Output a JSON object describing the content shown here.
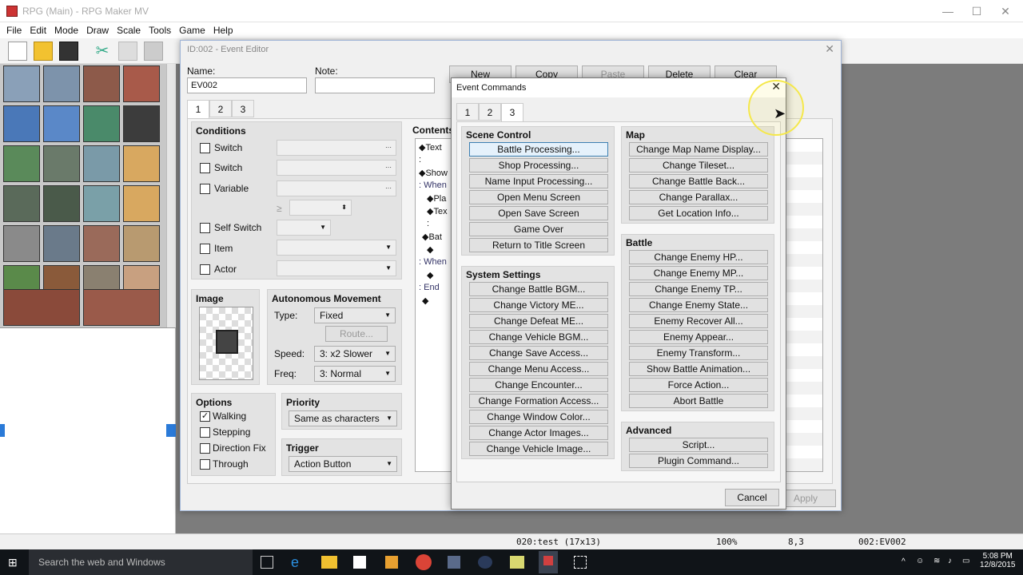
{
  "app": {
    "title": "RPG (Main) - RPG Maker MV",
    "menus": [
      "File",
      "Edit",
      "Mode",
      "Draw",
      "Scale",
      "Tools",
      "Game",
      "Help"
    ]
  },
  "event_editor": {
    "title": "ID:002 - Event Editor",
    "name_label": "Name:",
    "name_value": "EV002",
    "note_label": "Note:",
    "note_value": "",
    "buttons": [
      "New",
      "Copy",
      "Paste",
      "Delete",
      "Clear"
    ],
    "page_tabs": [
      "1",
      "2",
      "3"
    ],
    "conditions": {
      "heading": "Conditions",
      "rows": [
        "Switch",
        "Switch",
        "Variable"
      ],
      "ge": "≥",
      "self_switch": "Self Switch",
      "item": "Item",
      "actor": "Actor"
    },
    "image_heading": "Image",
    "autonomous": {
      "heading": "Autonomous Movement",
      "type_label": "Type:",
      "type_value": "Fixed",
      "route_button": "Route...",
      "speed_label": "Speed:",
      "speed_value": "3: x2 Slower",
      "freq_label": "Freq:",
      "freq_value": "3: Normal"
    },
    "options": {
      "heading": "Options",
      "items": [
        {
          "label": "Walking",
          "checked": true
        },
        {
          "label": "Stepping",
          "checked": false
        },
        {
          "label": "Direction Fix",
          "checked": false
        },
        {
          "label": "Through",
          "checked": false
        }
      ]
    },
    "priority": {
      "heading": "Priority",
      "value": "Same as characters"
    },
    "trigger": {
      "heading": "Trigger",
      "value": "Action Button"
    },
    "contents_heading": "Contents",
    "contents_lines": [
      "◆Text",
      ":",
      "◆Show",
      ": When",
      "◆Pla",
      "◆Tex",
      ":",
      "◆Bat",
      "◆",
      ": When",
      "◆",
      ": End",
      "◆"
    ],
    "apply_button": "Apply"
  },
  "event_commands": {
    "title": "Event Commands",
    "tabs": [
      "1",
      "2",
      "3"
    ],
    "active_tab": "3",
    "groups": {
      "scene_control": {
        "heading": "Scene Control",
        "buttons": [
          "Battle Processing...",
          "Shop Processing...",
          "Name Input Processing...",
          "Open Menu Screen",
          "Open Save Screen",
          "Game Over",
          "Return to Title Screen"
        ]
      },
      "system_settings": {
        "heading": "System Settings",
        "buttons": [
          "Change Battle BGM...",
          "Change Victory ME...",
          "Change Defeat ME...",
          "Change Vehicle BGM...",
          "Change Save Access...",
          "Change Menu Access...",
          "Change Encounter...",
          "Change Formation Access...",
          "Change Window Color...",
          "Change Actor Images...",
          "Change Vehicle Image..."
        ]
      },
      "map": {
        "heading": "Map",
        "buttons": [
          "Change Map Name Display...",
          "Change Tileset...",
          "Change Battle Back...",
          "Change Parallax...",
          "Get Location Info..."
        ]
      },
      "battle": {
        "heading": "Battle",
        "buttons": [
          "Change Enemy HP...",
          "Change Enemy MP...",
          "Change Enemy TP...",
          "Change Enemy State...",
          "Enemy Recover All...",
          "Enemy Appear...",
          "Enemy Transform...",
          "Show Battle Animation...",
          "Force Action...",
          "Abort Battle"
        ]
      },
      "advanced": {
        "heading": "Advanced",
        "buttons": [
          "Script...",
          "Plugin Command..."
        ]
      }
    },
    "cancel_button": "Cancel"
  },
  "statusbar": {
    "map": "020:test (17x13)",
    "zoom": "100%",
    "coords": "8,3",
    "event": "002:EV002"
  },
  "taskbar": {
    "search_placeholder": "Search the web and Windows",
    "time": "5:08 PM",
    "date": "12/8/2015"
  }
}
